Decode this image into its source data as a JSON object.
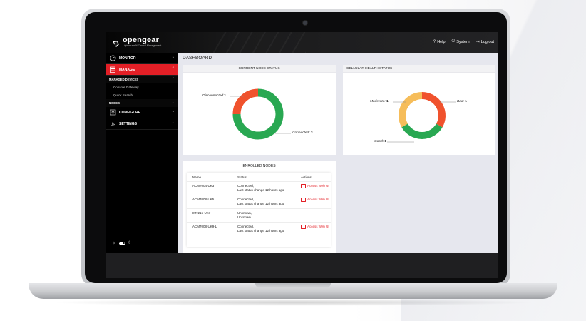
{
  "header": {
    "logo_name": "opengear",
    "logo_sub": "Lighthouse™ Central Management",
    "actions": [
      {
        "label": "Help",
        "icon": "help-circle-icon"
      },
      {
        "label": "System",
        "icon": "power-icon"
      },
      {
        "label": "Log out",
        "icon": "logout-icon"
      }
    ]
  },
  "sidebar": {
    "items": {
      "monitor": "MONITOR",
      "manage": "MANAGE",
      "managed_devices": "MANAGED DEVICES",
      "console_gateway": "Console Gateway",
      "quick_search": "Quick Search",
      "nodes": "NODES",
      "configure": "CONFIGURE",
      "settings": "SETTINGS"
    }
  },
  "page": {
    "title": "DASHBOARD"
  },
  "node_status": {
    "title": "CURRENT NODE STATUS",
    "segments": [
      {
        "label": "Disconnected:",
        "value": 1,
        "color": "#f0522d"
      },
      {
        "label": "Connected:",
        "value": 3,
        "color": "#29a852"
      }
    ]
  },
  "cellular": {
    "title": "CELLULAR HEALTH STATUS",
    "segments": [
      {
        "label": "Moderate:",
        "value": 1,
        "color": "#f6bd5a"
      },
      {
        "label": "Bad:",
        "value": 1,
        "color": "#f0522d"
      },
      {
        "label": "Good:",
        "value": 1,
        "color": "#29a852"
      }
    ]
  },
  "enrolled": {
    "title": "ENROLLED NODES",
    "columns": [
      "Name",
      "Status",
      "Actions"
    ],
    "rows": [
      {
        "name": "ACM7004-UK3",
        "status1": "Connected,",
        "status2": "Last status change 12 hours ago",
        "action": "Access Web UI"
      },
      {
        "name": "ACM7008-UK5",
        "status1": "Connected,",
        "status2": "Last status change 12 hours ago",
        "action": "Access Web UI"
      },
      {
        "name": "IM7216-UK7",
        "status1": "Unknown,",
        "status2": "Unknown",
        "action": ""
      },
      {
        "name": "ACM7008-UK9-L",
        "status1": "Connected,",
        "status2": "Last status change 12 hours ago",
        "action": "Access Web UI"
      }
    ]
  },
  "colors": {
    "accent": "#e31f26",
    "connected": "#29a852",
    "disconnected": "#f0522d",
    "moderate": "#f6bd5a"
  }
}
